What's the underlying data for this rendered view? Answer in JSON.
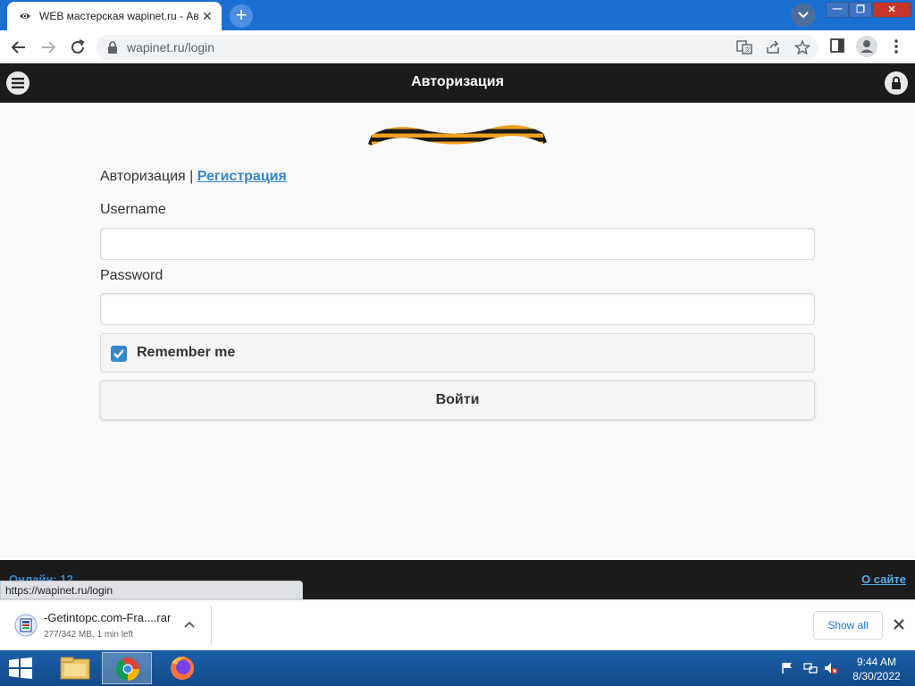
{
  "browser": {
    "tab_title": "WEB мастерская wapinet.ru - Ав",
    "url": "wapinet.ru/login",
    "status_url": "https://wapinet.ru/login"
  },
  "page": {
    "header_title": "Авторизация",
    "auth_label": "Авторизация",
    "auth_separator": " | ",
    "register_link": "Регистрация",
    "username_label": "Username",
    "username_value": "",
    "password_label": "Password",
    "password_value": "",
    "remember_label": "Remember me",
    "remember_checked": true,
    "submit_label": "Войти",
    "online_label": "Онлайн: 12",
    "about_link": "О сайте"
  },
  "download": {
    "file_name": "-Getintopc.com-Fra....rar",
    "status": "277/342 MB, 1 min left",
    "show_all": "Show all"
  },
  "taskbar": {
    "time": "9:44 AM",
    "date": "8/30/2022"
  },
  "colors": {
    "accent": "#3388cc",
    "header_bg": "#1b1b1b",
    "tabstrip_bg": "#1a6fd3"
  }
}
